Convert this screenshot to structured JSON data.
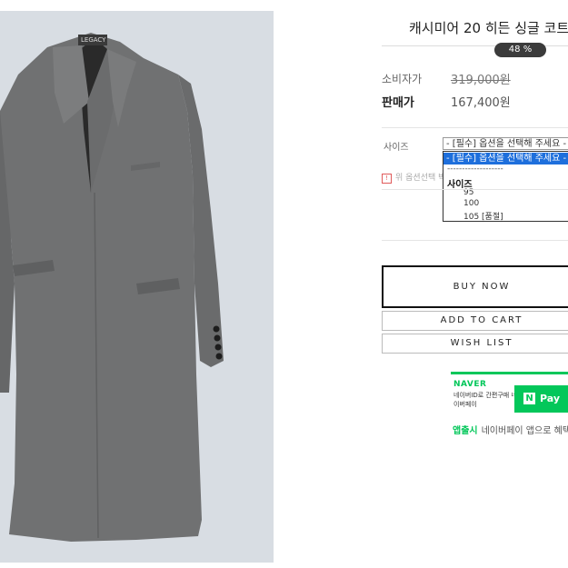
{
  "product": {
    "title": "캐시미어 20 히든 싱글 코트",
    "discount_badge": "48 %",
    "brand_label": "LEGACY"
  },
  "price": {
    "retail_label": "소비자가",
    "retail_value": "319,000원",
    "sale_label": "판매가",
    "sale_value": "167,400원"
  },
  "options": {
    "size_label": "사이즈",
    "select_value": "- [필수] 옵션을 선택해 주세요 -",
    "dropdown": {
      "selected": "- [필수] 옵션을 선택해 주세요 -",
      "separator": "-------------------",
      "group_label": "사이즈",
      "items": [
        "95",
        "100",
        "105 [품절]"
      ]
    },
    "notice": "위 옵션선택 박스를 선택하시면 아래에 상품이 추가됩니다."
  },
  "actions": {
    "buy_now": "BUY NOW",
    "add_to_cart": "ADD TO CART",
    "wish_list": "WISH LIST"
  },
  "naver_pay": {
    "brand": "NAVER",
    "desc": "네이버ID로 간편구매 네이버페이",
    "button_logo": "N",
    "button_label": "Pay"
  },
  "event": {
    "tag": "앱출시",
    "text": "네이버페이 앱으로 혜택"
  },
  "colors": {
    "naver_green": "#03c75a",
    "dropdown_highlight": "#1e6fdc",
    "badge_bg": "#3b3b3b",
    "photo_bg": "#d8dde3",
    "coat": "#707172"
  }
}
